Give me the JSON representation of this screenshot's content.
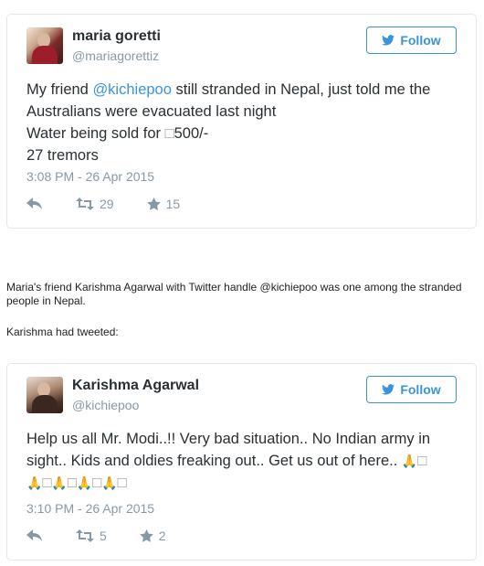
{
  "tweets": [
    {
      "name": "maria goretti",
      "handle": "@mariagorettiz",
      "follow_label": "Follow",
      "text_parts": {
        "before": "My friend ",
        "mention": "@kichiepoo",
        "after": " still stranded in Nepal, just told me the Australians were evacuated last night",
        "line2_a": "Water being sold for ",
        "line2_glyph": "□",
        "line2_b": "500/-",
        "line3": "27 tremors"
      },
      "timestamp": "3:08 PM - 26 Apr 2015",
      "retweets": "29",
      "favorites": "15"
    },
    {
      "name": "Karishma Agarwal",
      "handle": "@kichiepoo",
      "follow_label": "Follow",
      "text_main": "Help us all Mr. Modi..!! Very bad situation.. No Indian army in sight.. Kids and oldies freaking out.. Get us out of here.. ",
      "emoji_glyph": "🙏",
      "box_glyph": "□",
      "timestamp": "3:10 PM - 26 Apr 2015",
      "retweets": "5",
      "favorites": "2"
    }
  ],
  "captions": {
    "first": "Maria's friend  Karishma Agarwal with Twitter handle @kichiepoo was one among the stranded people in Nepal.",
    "second": "Karishma had tweeted:"
  },
  "icons": {
    "reply": "reply-icon",
    "retweet": "retweet-icon",
    "favorite": "star-icon",
    "follow": "twitter-bird-icon"
  },
  "colors": {
    "accent": "#3b94d9",
    "muted": "#8899a6",
    "text": "#292f33",
    "border": "#e1e8ed"
  }
}
